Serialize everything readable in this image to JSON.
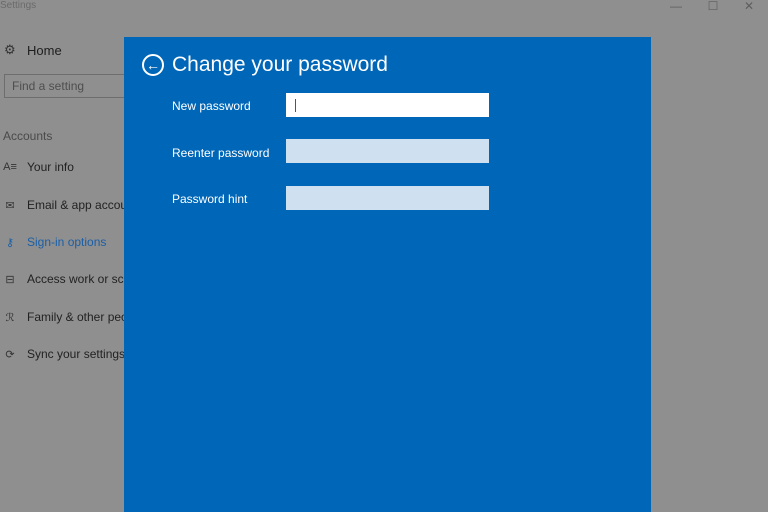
{
  "window": {
    "title": "Settings",
    "controls": {
      "minimize": "—",
      "maximize": "☐",
      "close": "✕"
    }
  },
  "sidebar": {
    "home": {
      "icon": "gear-icon",
      "glyph": "⚙",
      "label": "Home"
    },
    "search": {
      "placeholder": "Find a setting",
      "value": ""
    },
    "section_heading": "Accounts",
    "items": [
      {
        "icon": "person-card-icon",
        "glyph": "A≡",
        "label": "Your info",
        "active": false
      },
      {
        "icon": "mail-icon",
        "glyph": "✉",
        "label": "Email & app accounts",
        "active": false
      },
      {
        "icon": "key-icon",
        "glyph": "⚷",
        "label": "Sign-in options",
        "active": true
      },
      {
        "icon": "briefcase-icon",
        "glyph": "⊟",
        "label": "Access work or school",
        "active": false
      },
      {
        "icon": "family-icon",
        "glyph": "ℛ",
        "label": "Family & other people",
        "active": false
      },
      {
        "icon": "sync-icon",
        "glyph": "⟳",
        "label": "Sync your settings",
        "active": false
      }
    ]
  },
  "dialog": {
    "back_glyph": "←",
    "title": "Change your password",
    "fields": [
      {
        "label": "New password",
        "value": "",
        "focused": true
      },
      {
        "label": "Reenter password",
        "value": "",
        "focused": false
      },
      {
        "label": "Password hint",
        "value": "",
        "focused": false
      }
    ],
    "accent_color": "#0067b8"
  }
}
